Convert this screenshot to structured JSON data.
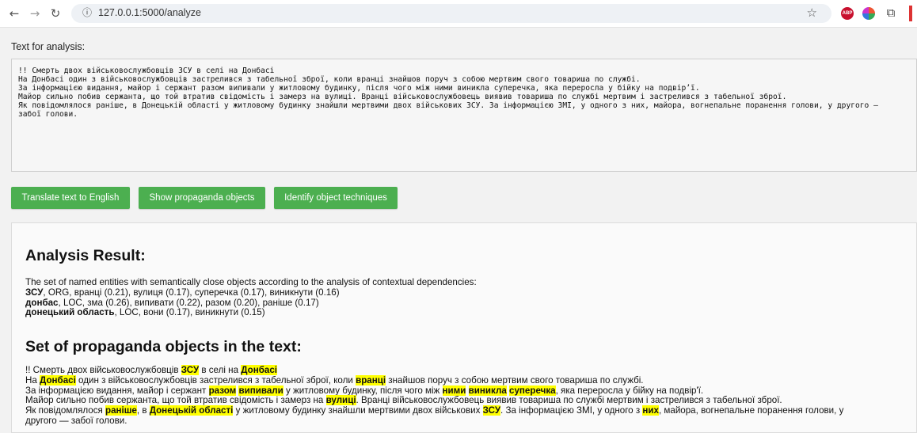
{
  "browser": {
    "url": "127.0.0.1:5000/analyze",
    "ext_abp": "ABP"
  },
  "input": {
    "label": "Text for analysis:",
    "value": "!! Смерть двох військовослужбовців ЗСУ в селі на Донбасі\nНа Донбасі один з військовослужбовців застрелився з табельної зброї, коли вранці знайшов поруч з собою мертвим свого товариша по службі.\nЗа інформацією видання, майор і сержант разом випивали у житловому будинку, після чого між ними виникла суперечка, яка переросла у бійку на подвір’ї.\nМайор сильно побив сержанта, що той втратив свідомість і замерз на вулиці. Вранці військовослужбовець виявив товариша по службі мертвим і застрелився з табельної зброї.\nЯк повідомлялося раніше, в Донецькій області у житловому будинку знайшли мертвими двох військових ЗСУ. За інформацією ЗМІ, у одного з них, майора, вогнепальне поранення голови, у другого —\nзабої голови."
  },
  "buttons": {
    "translate": "Translate text to English",
    "show_objects": "Show propaganda objects",
    "identify": "Identify object techniques"
  },
  "result": {
    "title": "Analysis Result:",
    "entities_intro": "The set of named entities with semantically close objects according to the analysis of contextual dependencies:",
    "entities": [
      {
        "name": "ЗСУ",
        "rest": ", ORG, вранці (0.21), вулиця (0.17), суперечка (0.17), виникнути (0.16)"
      },
      {
        "name": "донбас",
        "rest": ", LOC, зма (0.26), випивати (0.22), разом (0.20), раніше (0.17)"
      },
      {
        "name": "донецький область",
        "rest": ", LOC, вони (0.17), виникнути (0.15)"
      }
    ],
    "propaganda_title": "Set of propaganda objects in the text:",
    "lines": [
      [
        {
          "t": "!! Смерть двох військовослужбовців "
        },
        {
          "t": "ЗСУ",
          "h": true
        },
        {
          "t": " в селі на "
        },
        {
          "t": "Донбасі",
          "h": true
        }
      ],
      [
        {
          "t": "На "
        },
        {
          "t": "Донбасі",
          "h": true
        },
        {
          "t": " один з військовослужбовців застрелився з табельної зброї, коли "
        },
        {
          "t": "вранці",
          "h": true
        },
        {
          "t": " знайшов поруч з собою мертвим свого товариша по службі."
        }
      ],
      [
        {
          "t": "За інформацією видання, майор і сержант "
        },
        {
          "t": "разом",
          "h": true
        },
        {
          "t": " "
        },
        {
          "t": "випивали",
          "h": true
        },
        {
          "t": " у житловому будинку, після чого між "
        },
        {
          "t": "ними",
          "h": true
        },
        {
          "t": " "
        },
        {
          "t": "виникла",
          "h": true
        },
        {
          "t": " "
        },
        {
          "t": "суперечка",
          "h": true
        },
        {
          "t": ", яка переросла у бійку на подвір'ї."
        }
      ],
      [
        {
          "t": "Майор сильно побив сержанта, що той втратив свідомість і замерз на "
        },
        {
          "t": "вулиці",
          "h": true
        },
        {
          "t": ". Вранці військовослужбовець виявив товариша по службі мертвим і застрелився з табельної зброї."
        }
      ],
      [
        {
          "t": "Як повідомлялося "
        },
        {
          "t": "раніше",
          "h": true
        },
        {
          "t": ", в "
        },
        {
          "t": "Донецькій області",
          "h": true
        },
        {
          "t": " у житловому будинку знайшли мертвими двох військових "
        },
        {
          "t": "ЗСУ",
          "h": true
        },
        {
          "t": ". За інформацією ЗМІ, у одного з "
        },
        {
          "t": "них",
          "h": true
        },
        {
          "t": ", майора, вогнепальне поранення голови, у"
        }
      ],
      [
        {
          "t": "другого — забої голови."
        }
      ]
    ]
  }
}
